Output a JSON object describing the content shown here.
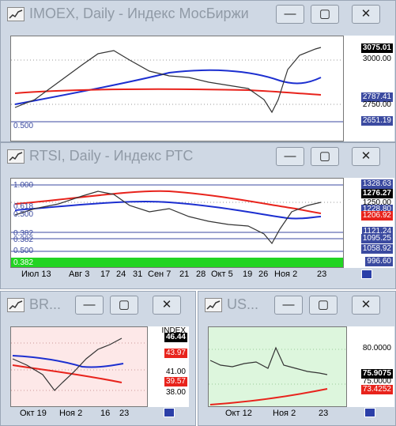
{
  "windows": {
    "imoex": {
      "title": "IMOEX, Daily - Индекс МосБиржи",
      "price_current": "3075.01",
      "tick_3000": "3000.00",
      "price_ma_blue": "2787.41",
      "tick_2750": "2750.00",
      "price_level": "2651.19",
      "fib_0500": "0.500"
    },
    "rtsi": {
      "title": "RTSI, Daily - Индекс РТС",
      "levels": {
        "l1328": "1328.63",
        "l1276": "1276.27",
        "l1250": "1250.00",
        "l1228": "1228.80",
        "l1206": "1206.92",
        "l1121": "1121.24",
        "l1095": "1095.25",
        "l1058": "1058.92",
        "l996": "996.60"
      },
      "fib_labels": [
        "1.000",
        "0.618",
        "0.500",
        "0.382",
        "0.382",
        "0.500",
        "0.382"
      ],
      "time_labels": [
        "Июл 13",
        "Авг 3",
        "17",
        "24",
        "31",
        "Сен 7",
        "21",
        "28",
        "Окт 5",
        "19",
        "26",
        "Ноя 2",
        "23"
      ]
    },
    "br": {
      "title": "BR...",
      "tick_top": "INDEX",
      "price_current": "46.44",
      "price_red_a": "43.97",
      "tick_41": "41.00",
      "price_red_b": "39.57",
      "tick_38": "38.00",
      "time_labels": [
        "Окт 19",
        "Ноя 2",
        "16",
        "23"
      ]
    },
    "us": {
      "title": "US...",
      "tick_80": "80.0000",
      "price_current": "75.9075",
      "tick_75": "75.0000",
      "price_red": "73.4252",
      "time_labels": [
        "Окт 12",
        "Ноя 2",
        "23"
      ]
    }
  },
  "buttons": {
    "minimize": "—",
    "maximize": "▢",
    "close": "✕"
  },
  "colors": {
    "ma_red": "#e8231c",
    "ma_blue": "#1c2fd0",
    "fib_green": "#22d422",
    "bg_pink": "#fde8e8",
    "bg_green": "#ddf6dd"
  }
}
